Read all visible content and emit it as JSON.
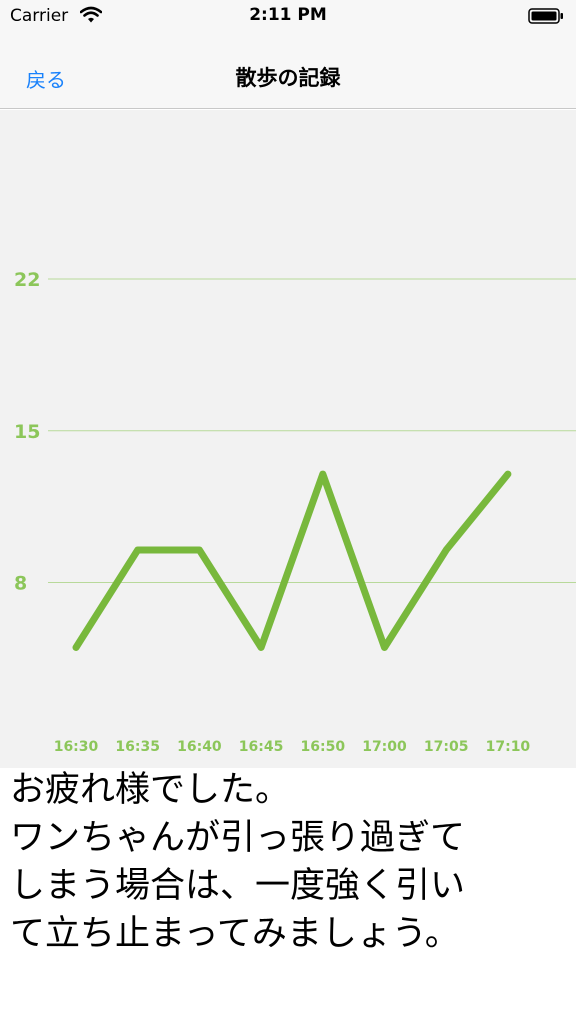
{
  "status": {
    "carrier": "Carrier",
    "time": "2:11 PM"
  },
  "nav": {
    "back_label": "戻る",
    "title": "散歩の記録"
  },
  "colors": {
    "accent": "#78b83c",
    "grid": "#b8d99a",
    "label": "#8cc65a",
    "link": "#1a82fb"
  },
  "message": "お疲れ様でした。\nワンちゃんが引っ張り過ぎて\nしまう場合は、一度強く引い\nて立ち止まってみましょう。",
  "chart_data": {
    "type": "line",
    "categories": [
      "16:30",
      "16:35",
      "16:40",
      "16:45",
      "16:50",
      "17:00",
      "17:05",
      "17:10"
    ],
    "values": [
      5,
      9.5,
      9.5,
      5,
      13,
      5,
      9.5,
      13
    ],
    "yticks": [
      8,
      15,
      22
    ],
    "ylim": [
      1.1,
      29.8
    ],
    "grid": true,
    "legend": "none"
  }
}
